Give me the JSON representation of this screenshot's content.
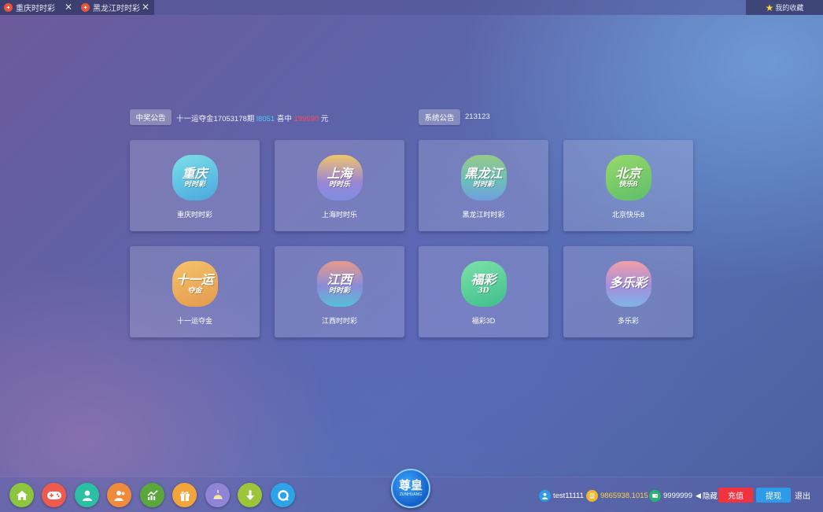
{
  "tabs": [
    {
      "label": "重庆时时彩",
      "close": "✕"
    },
    {
      "label": "黑龙江时时彩",
      "close": "✕"
    }
  ],
  "favorites": {
    "label": "我的收藏",
    "icon": "star-icon"
  },
  "win_notice": {
    "button": "中奖公告",
    "prefix": "十一运夺金17053178期",
    "issue": "l8051",
    "middle": "喜中",
    "amount": "199590",
    "suffix": "元"
  },
  "system_notice": {
    "button": "系统公告",
    "text": "213123"
  },
  "games": [
    {
      "name": "重庆时时彩",
      "badge_big": "重庆",
      "badge_small": "时时彩"
    },
    {
      "name": "上海时时乐",
      "badge_big": "上海",
      "badge_small": "时时乐"
    },
    {
      "name": "黑龙江时时彩",
      "badge_big": "黑龙江",
      "badge_small": "时时彩"
    },
    {
      "name": "北京快乐8",
      "badge_big": "北京",
      "badge_small": "快乐8"
    },
    {
      "name": "十一运夺金",
      "badge_big": "十一运",
      "badge_small": "夺金"
    },
    {
      "name": "江西时时彩",
      "badge_big": "江西",
      "badge_small": "时时彩"
    },
    {
      "name": "福彩3D",
      "badge_big": "福彩",
      "badge_small": "3D"
    },
    {
      "name": "多乐彩",
      "badge_big": "多乐彩",
      "badge_small": ""
    }
  ],
  "bottom_nav": [
    {
      "icon": "home-icon",
      "color": "#8cc63f"
    },
    {
      "icon": "gamepad-icon",
      "color": "#ef5a4c"
    },
    {
      "icon": "user-icon",
      "color": "#2bbfa3"
    },
    {
      "icon": "agent-icon",
      "color": "#f08b3c"
    },
    {
      "icon": "trend-chart-icon",
      "color": "#5aa83c"
    },
    {
      "icon": "gift-icon",
      "color": "#f3a53c"
    },
    {
      "icon": "lamp-icon",
      "color": "#8f84d6"
    },
    {
      "icon": "download-icon",
      "color": "#9ec43a"
    },
    {
      "icon": "chat-icon",
      "color": "#2ea4e8"
    }
  ],
  "logo": {
    "main": "尊皇",
    "sub": "ZUNHUANG"
  },
  "account": {
    "username": "test11111",
    "balance": "9865938.1015",
    "points": "9999999",
    "hide_label": "隐藏",
    "recharge_label": "充值",
    "withdraw_label": "提现",
    "logout_label": "退出"
  },
  "colors": {
    "balance": "#ffd23c",
    "recharge": "#f0333f",
    "withdraw": "#2d9be8"
  }
}
